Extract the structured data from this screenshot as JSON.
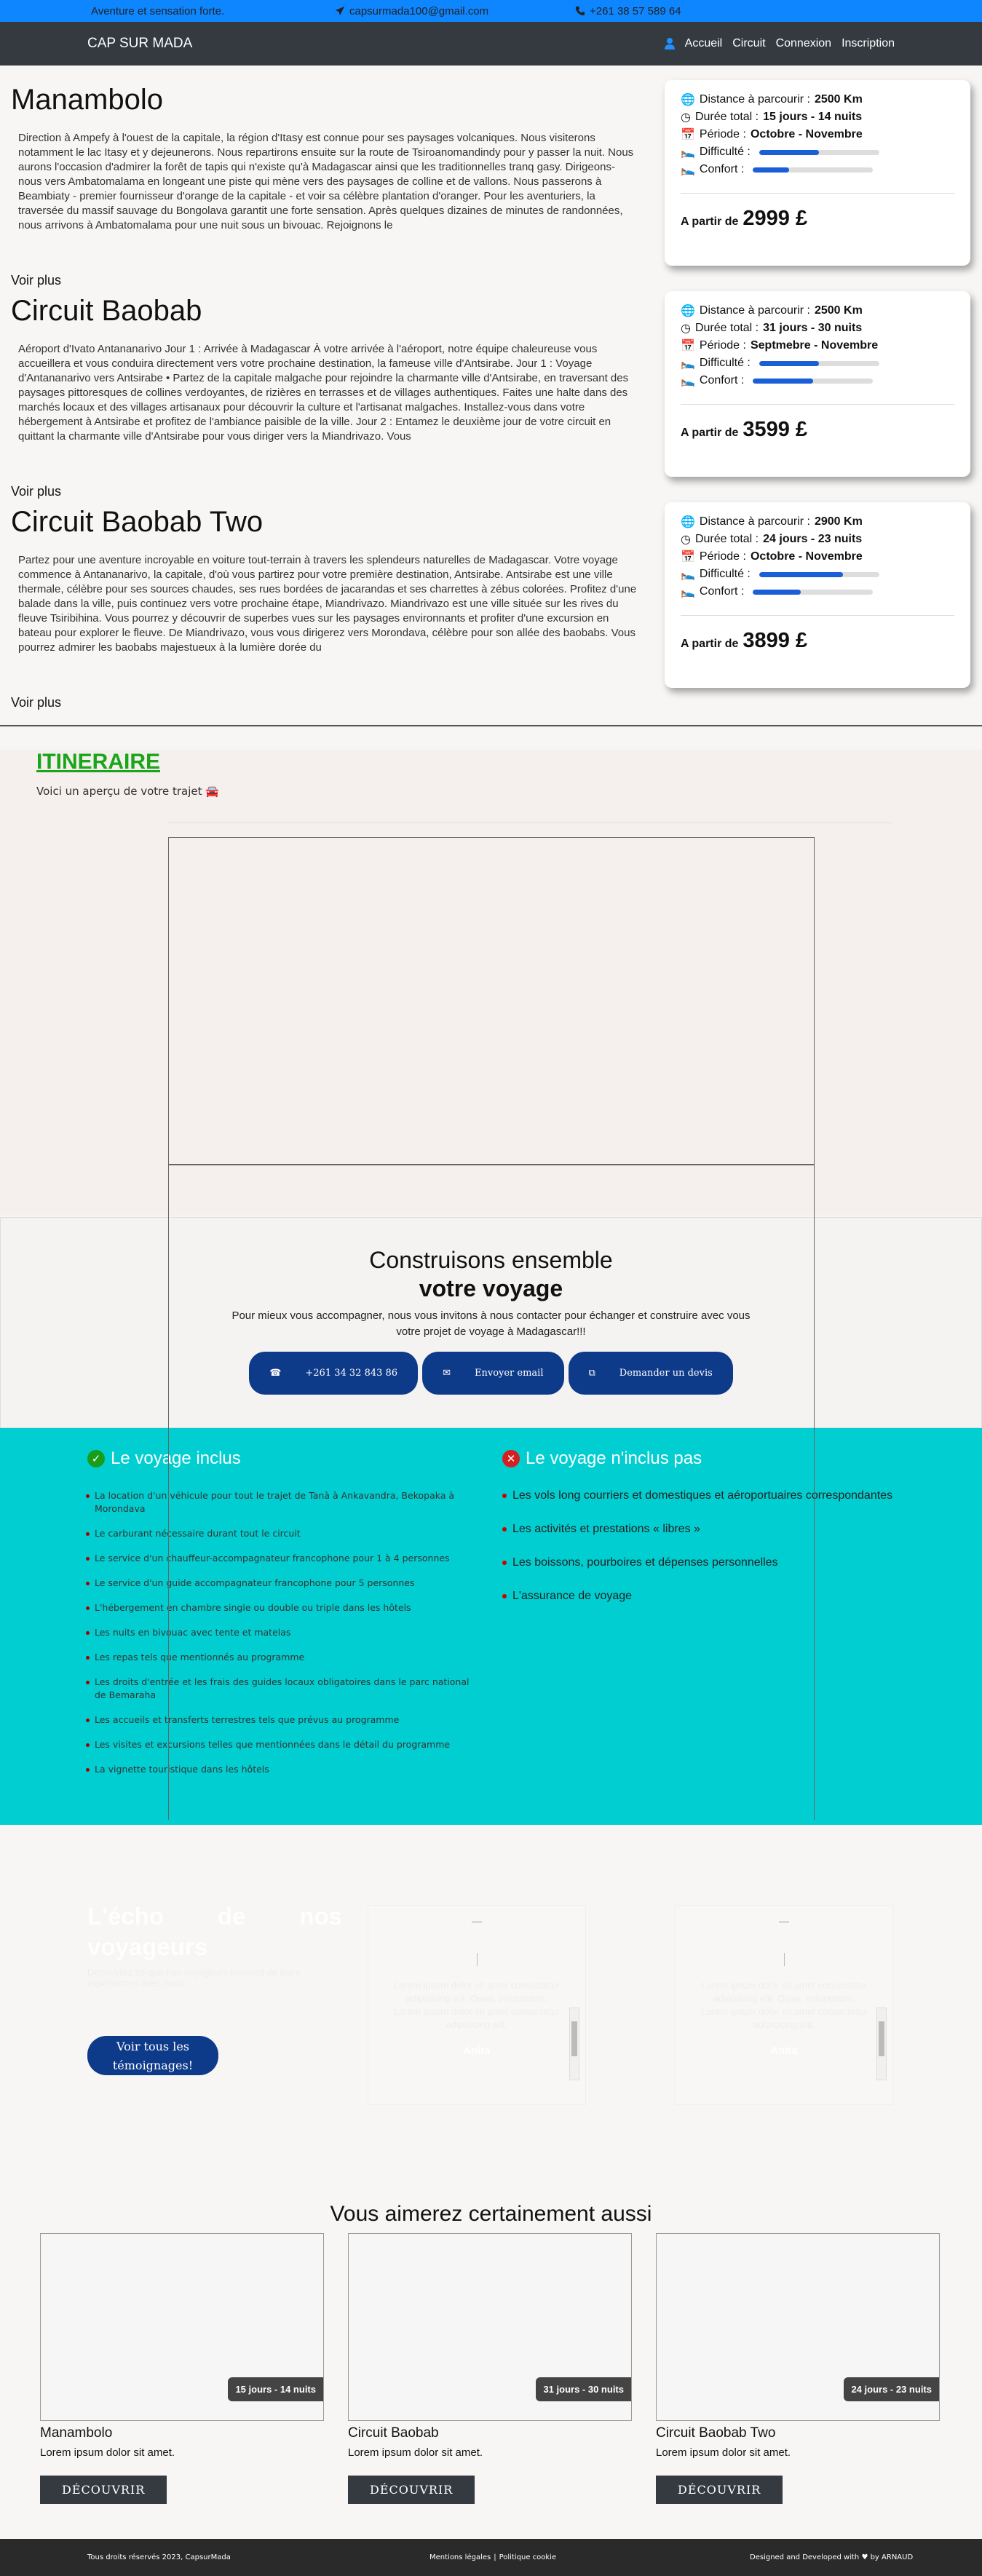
{
  "topbar": {
    "tagline": "Aventure et sensation forte.",
    "email": "capsurmada100@gmail.com",
    "phone": "+261 38 57 589 64"
  },
  "navbar": {
    "brand": "CAP SUR MADA",
    "links": [
      "Accueil",
      "Circuit",
      "Connexion",
      "Inscription"
    ]
  },
  "labels": {
    "distance": "Distance à parcourir :",
    "duree": "Durée total :",
    "periode": "Période :",
    "difficulte": "Difficulté :",
    "confort": "Confort :",
    "a_partir": "A partir de",
    "voir_plus": "Voir plus"
  },
  "trips": [
    {
      "title": "Manambolo",
      "description": "Direction à Ampefy à l'ouest de la capitale, la région d'Itasy est connue pour ses paysages volcaniques. Nous visiterons notamment le lac Itasy et y dejeunerons. Nous repartirons ensuite sur la route de Tsiroanomandindy pour y passer la nuit. Nous aurons l'occasion d'admirer la forêt de tapis qui n'existe qu'à Madagascar ainsi que les traditionnelles tranq gasy. Dirigeons-nous vers Ambatomalama en longeant une piste qui mène vers des paysages de colline et de vallons. Nous passerons à Beambiaty - premier fournisseur d'orange de la capitale - et voir sa célèbre plantation d'oranger. Pour les aventuriers, la traversée du massif sauvage du Bongolava garantit une forte sensation. Après quelques dizaines de minutes de randonnées, nous arrivons à Ambatomalama pour une nuit sous un bivouac. Rejoignons le",
      "distance": "2500 Km",
      "duree": "15 jours - 14 nuits",
      "periode": "Octobre - Novembre",
      "difficulte": 0.5,
      "confort": 0.3,
      "price": "2999 £"
    },
    {
      "title": "Circuit Baobab",
      "description": "Aéroport d'Ivato Antananarivo Jour 1 : Arrivée à Madagascar À votre arrivée à l'aéroport, notre équipe chaleureuse vous accueillera et vous conduira directement vers votre prochaine destination, la fameuse ville d'Antsirabe. Jour 1 : Voyage d'Antananarivo vers Antsirabe • Partez de la capitale malgache pour rejoindre la charmante ville d'Antsirabe, en traversant des paysages pittoresques de collines verdoyantes, de rizières en terrasses et de villages authentiques. Faites une halte dans des marchés locaux et des villages artisanaux pour découvrir la culture et l'artisanat malgaches. Installez-vous dans votre hébergement à Antsirabe et profitez de l'ambiance paisible de la ville. Jour 2 : Entamez le deuxième jour de votre circuit en quittant la charmante ville d'Antsirabe pour vous diriger vers la Miandrivazo. Vous",
      "distance": "2500 Km",
      "duree": "31 jours - 30 nuits",
      "periode": "Septmebre - Novembre",
      "difficulte": 0.5,
      "confort": 0.5,
      "price": "3599 £"
    },
    {
      "title": "Circuit Baobab Two",
      "description": "Partez pour une aventure incroyable en voiture tout-terrain à travers les splendeurs naturelles de Madagascar. Votre voyage commence à Antananarivo, la capitale, d'où vous partirez pour votre première destination, Antsirabe. Antsirabe est une ville thermale, célèbre pour ses sources chaudes, ses rues bordées de jacarandas et ses charrettes à zébus colorées. Profitez d'une balade dans la ville, puis continuez vers votre prochaine étape, Miandrivazo. Miandrivazo est une ville située sur les rives du fleuve Tsiribihina. Vous pourrez y découvrir de superbes vues sur les paysages environnants et profiter d'une excursion en bateau pour explorer le fleuve. De Miandrivazo, vous vous dirigerez vers Morondava, célèbre pour son allée des baobabs. Vous pourrez admirer les baobabs majestueux à la lumière dorée du",
      "distance": "2900 Km",
      "duree": "24 jours - 23 nuits",
      "periode": "Octobre - Novembre",
      "difficulte": 0.7,
      "confort": 0.4,
      "price": "3899 £"
    }
  ],
  "itinerary": {
    "title": "ITINERAIRE",
    "subtitle": "Voici un aperçu de votre trajet"
  },
  "build": {
    "line1": "Construisons ensemble",
    "line2": "votre voyage",
    "text": "Pour mieux vous accompagner, nous vous invitons à nous contacter pour échanger et construire avec vous votre projet de voyage à Madagascar!!!",
    "phone_btn": "+261 34 32 843 86",
    "email_btn": "Envoyer email",
    "quote_btn": "Demander un devis"
  },
  "included": {
    "title": "Le voyage inclus",
    "items": [
      "La location d'un véhicule pour tout le trajet de Tanà à Ankavandra, Bekopaka à Morondava",
      "Le carburant nécessaire durant tout le circuit",
      "Le service d'un chauffeur-accompagnateur francophone pour 1 à 4 personnes",
      "Le service d'un guide accompagnateur francophone pour 5 personnes",
      "L'hébergement en chambre single ou double ou triple dans les hôtels",
      "Les nuits en bivouac avec tente et matelas",
      "Les repas tels que mentionnés au programme",
      "Les droits d'entrée et les frais des guides locaux obligatoires dans le parc national de Bemaraha",
      "Les accueils et transferts terrestres tels que prévus au programme",
      "Les visites et excursions telles que mentionnées dans le détail du programme",
      "La vignette touristique dans les hôtels"
    ]
  },
  "excluded": {
    "title": "Le voyage n'inclus pas",
    "items": [
      "Les vols long courriers et domestiques et aéroportuaires correspondantes",
      "Les activités et prestations « libres »",
      "Les boissons, pourboires et dépenses personnelles",
      "L'assurance de voyage"
    ]
  },
  "echo": {
    "title": "L'écho de nos voyageurs",
    "subtitle": "Découvrez ce que nos voyageurs pensent de leurs expériences avec nous",
    "button": "Voir tous les témoignages!",
    "testimonials": [
      {
        "text": "Lorem ipsum dolor sit amet consectetur adipisicing elit. Quae, voluptatum. Lorem ipsum dolor sit amet consectetur adipisicing elit.",
        "name": "Anita"
      },
      {
        "text": "Lorem ipsum dolor sit amet consectetur adipisicing elit. Quae, voluptatum. Lorem ipsum dolor sit amet consectetur adipisicing elit.",
        "name": "Anita"
      }
    ]
  },
  "like": {
    "title": "Vous aimerez certainement aussi",
    "cards": [
      {
        "badge": "15 jours - 14 nuits",
        "title": "Manambolo",
        "desc": "Lorem ipsum dolor sit amet.",
        "button": "DÉCOUVRIR"
      },
      {
        "badge": "31 jours - 30 nuits",
        "title": "Circuit Baobab",
        "desc": "Lorem ipsum dolor sit amet.",
        "button": "DÉCOUVRIR"
      },
      {
        "badge": "24 jours - 23 nuits",
        "title": "Circuit Baobab Two",
        "desc": "Lorem ipsum dolor sit amet.",
        "button": "DÉCOUVRIR"
      }
    ]
  },
  "footer": {
    "copyright": "Tous droits réservés 2023, CapsurMada",
    "legal": "Mentions légales",
    "sep": "|",
    "cookies": "Politique cookie",
    "credit": "Designed and Developed with ♥ by ARNAUD"
  }
}
